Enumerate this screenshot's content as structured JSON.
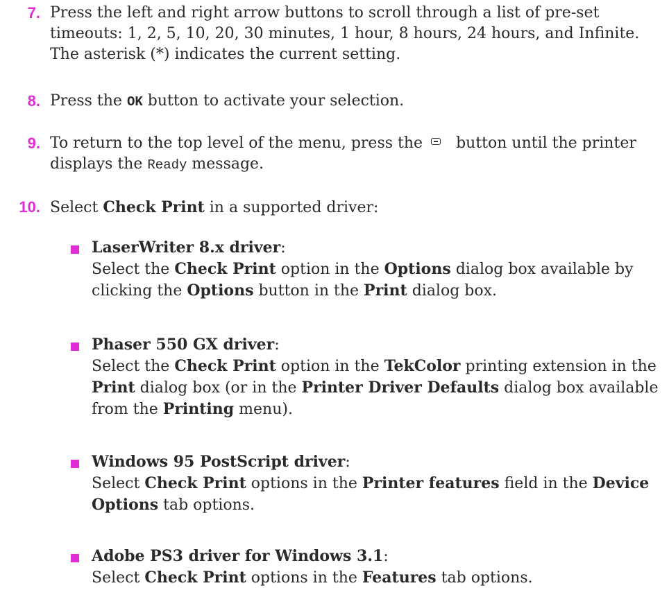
{
  "steps": [
    {
      "number": "7.",
      "text": "Press the left and right arrow buttons to scroll through a list of pre-set timeouts: 1, 2, 5, 10, 20, 30 minutes, 1 hour, 8 hours, 24 hours, and Infinite. The asterisk (*) indicates the current setting."
    },
    {
      "number": "8.",
      "pre": "Press the ",
      "bold_mono": "OK",
      "post": " button to activate your selection."
    },
    {
      "number": "9.",
      "pre": "To return to the top level of the menu, press the",
      "icon": "menu-exit-icon",
      "mid": "button until the printer displays the ",
      "mono": "Ready",
      "post": " message."
    },
    {
      "number": "10.",
      "pre": "Select ",
      "bold": "Check Print",
      "post": " in a supported driver:"
    }
  ],
  "drivers": [
    {
      "title": "LaserWriter 8.x driver",
      "colon": ":",
      "parts": [
        "Select the ",
        "Check Print",
        " option in the ",
        "Options",
        " dialog box available by clicking the ",
        "Options",
        " button in the ",
        "Print",
        " dialog box."
      ]
    },
    {
      "title": "Phaser 550 GX driver",
      "colon": ":",
      "parts": [
        "Select the ",
        "Check Print",
        " option in the ",
        "TekColor",
        " printing extension in the ",
        "Print",
        " dialog box (or in the ",
        "Printer Driver Defaults",
        " dialog box available from the ",
        "Printing",
        " menu)."
      ]
    },
    {
      "title": "Windows 95 PostScript driver",
      "colon": ":",
      "parts": [
        "Select ",
        "Check Print",
        " options in the ",
        "Printer features",
        " field in the ",
        "Device Options",
        " tab options."
      ]
    },
    {
      "title": "Adobe PS3 driver for Windows 3.1",
      "colon": ":",
      "parts": [
        "Select ",
        "Check Print",
        " options in the ",
        "Features",
        " tab options."
      ]
    }
  ],
  "colors": {
    "accent": "#e02bd6",
    "text": "#2a2a2a"
  }
}
